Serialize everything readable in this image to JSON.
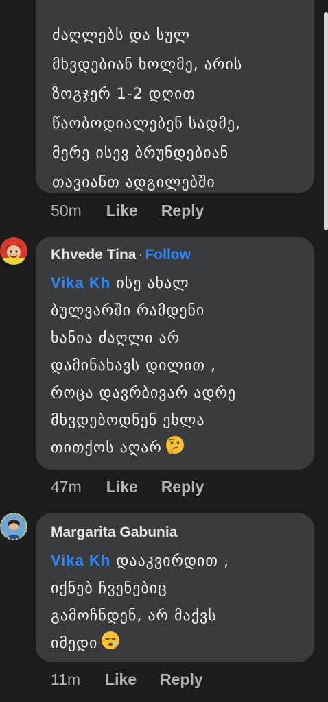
{
  "comments": [
    {
      "body_lines": [
        "ძაღლებს და სულ",
        "მხვდებიან ხოლმე, არის",
        "ზოგჯერ 1-2 დღით",
        "წაობოდიალებენ სადმე,",
        "მერე ისევ ბრუნდებიან",
        "თავიანთ ადგილებში"
      ],
      "time": "50m",
      "like_label": "Like",
      "reply_label": "Reply"
    },
    {
      "author": "Khvede Tina",
      "separator": "·",
      "follow_label": "Follow",
      "mention": "Vika Kh",
      "body_first": "ისე ახალ",
      "body_lines": [
        "ბულვარში რამდენი",
        "ხანია ძაღლი არ",
        "დამინახავს დილით ,",
        "როცა დავრბივარ ადრე",
        "მხვდებოდნენ ეხლა"
      ],
      "body_last": "თითქოს აღარ",
      "emoji_icon": "thinking-face-icon",
      "time": "47m",
      "like_label": "Like",
      "reply_label": "Reply"
    },
    {
      "author": "Margarita Gabunia",
      "mention": "Vika Kh",
      "body_first": "დააკვირდით ,",
      "body_lines": [
        "იქნებ ჩვენებიც",
        "გამოჩნდენ, არ მაქვს"
      ],
      "body_last": "იმედი",
      "emoji_icon": "sleepy-face-icon",
      "time": "11m",
      "like_label": "Like",
      "reply_label": "Reply"
    }
  ],
  "colors": {
    "background": "#1c1c1d",
    "bubble": "#3a3b3c",
    "link": "#2d88ff",
    "meta": "#b0b3b8"
  }
}
